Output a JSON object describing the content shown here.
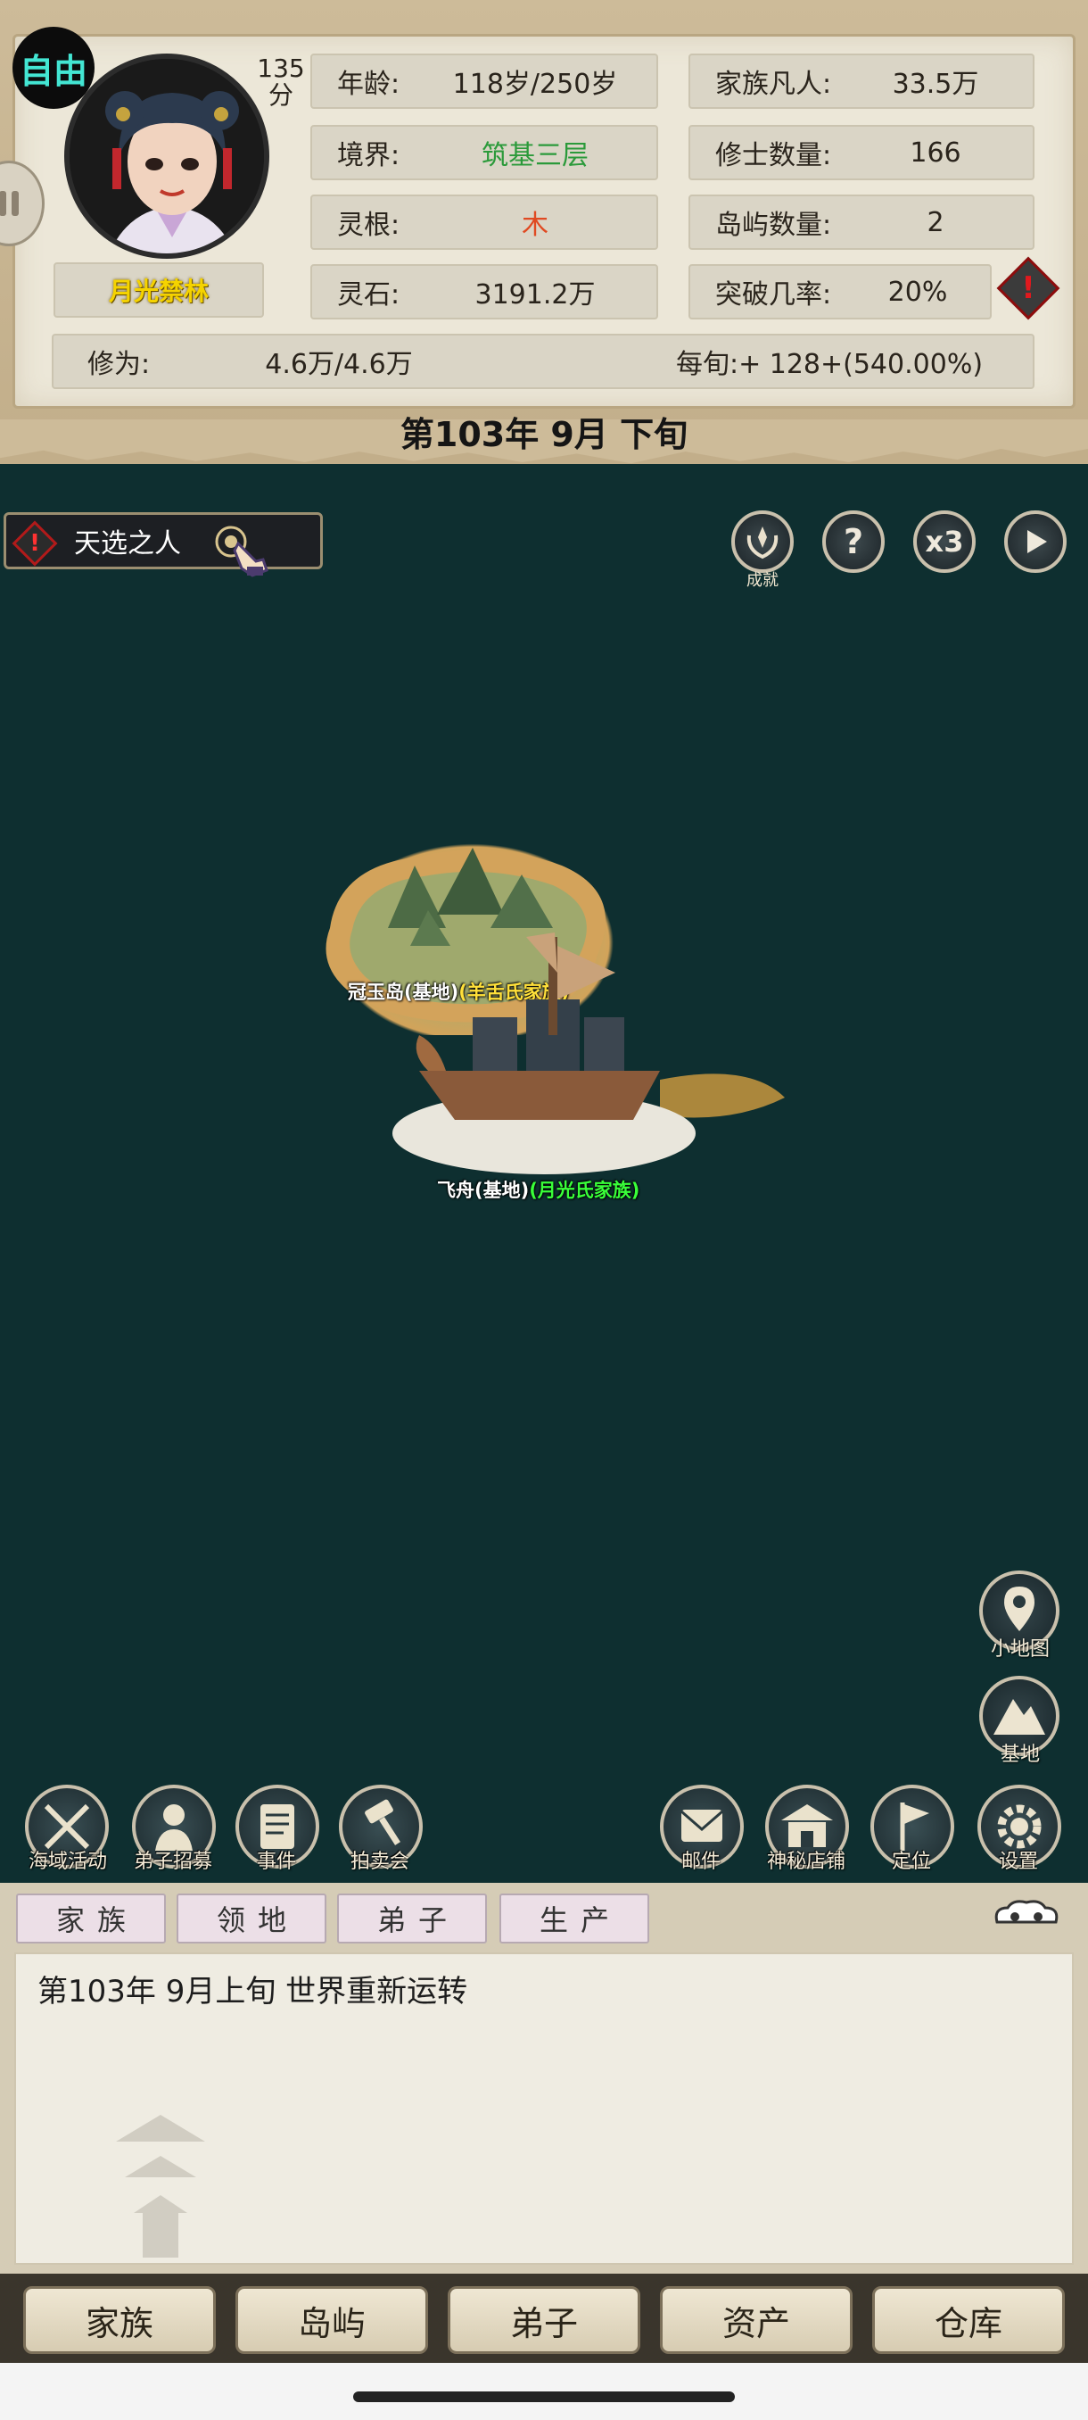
{
  "header": {
    "mode_badge": "自由",
    "score": "135\n分",
    "character_name": "月光禁林",
    "stats_left": [
      {
        "label": "年龄:",
        "value": "118岁/250岁"
      },
      {
        "label": "境界:",
        "value": "筑基三层"
      },
      {
        "label": "灵根:",
        "value": "木"
      },
      {
        "label": "灵石:",
        "value": "3191.2万"
      }
    ],
    "stats_right": [
      {
        "label": "家族凡人:",
        "value": "33.5万"
      },
      {
        "label": "修士数量:",
        "value": "166"
      },
      {
        "label": "岛屿数量:",
        "value": "2"
      },
      {
        "label": "突破几率:",
        "value": "20%"
      }
    ],
    "cultivation": {
      "label": "修为:",
      "value": "4.6万/4.6万",
      "per_period": "每旬:+ 128+(540.00%)"
    },
    "warning_glyph": "!"
  },
  "date_title": "第103年 9月 下旬",
  "quest": {
    "label": "天选之人",
    "glyph": "!"
  },
  "top_controls": {
    "achievement_label": "成就",
    "help_glyph": "?",
    "speed_label": "x3",
    "play_glyph": "▶"
  },
  "map": {
    "island_name": "冠玉岛(基地)",
    "island_family": "(羊舌氏家族)",
    "ship_name": "飞舟(基地)",
    "ship_family": "(月光氏家族)"
  },
  "side_buttons": [
    {
      "label": "小地图"
    },
    {
      "label": "基地"
    }
  ],
  "bottom_icons_left": [
    {
      "label": "海域活动"
    },
    {
      "label": "弟子招募"
    },
    {
      "label": "事件"
    },
    {
      "label": "拍卖会"
    }
  ],
  "bottom_icons_right": [
    {
      "label": "邮件"
    },
    {
      "label": "神秘店铺"
    },
    {
      "label": "定位"
    },
    {
      "label": "设置"
    }
  ],
  "log_tabs": [
    "家族",
    "领地",
    "弟子",
    "生产"
  ],
  "log_entry": "第103年   9月上旬 世界重新运转",
  "nav": [
    "家族",
    "岛屿",
    "弟子",
    "资产",
    "仓库"
  ],
  "colors": {
    "sea": "#0e2f30",
    "realm_green": "#2b9a3a",
    "root_red": "#e04a22",
    "name_gold": "#f5d300",
    "island_family_yellow": "#ffe03a",
    "ship_family_green": "#39ff39"
  }
}
